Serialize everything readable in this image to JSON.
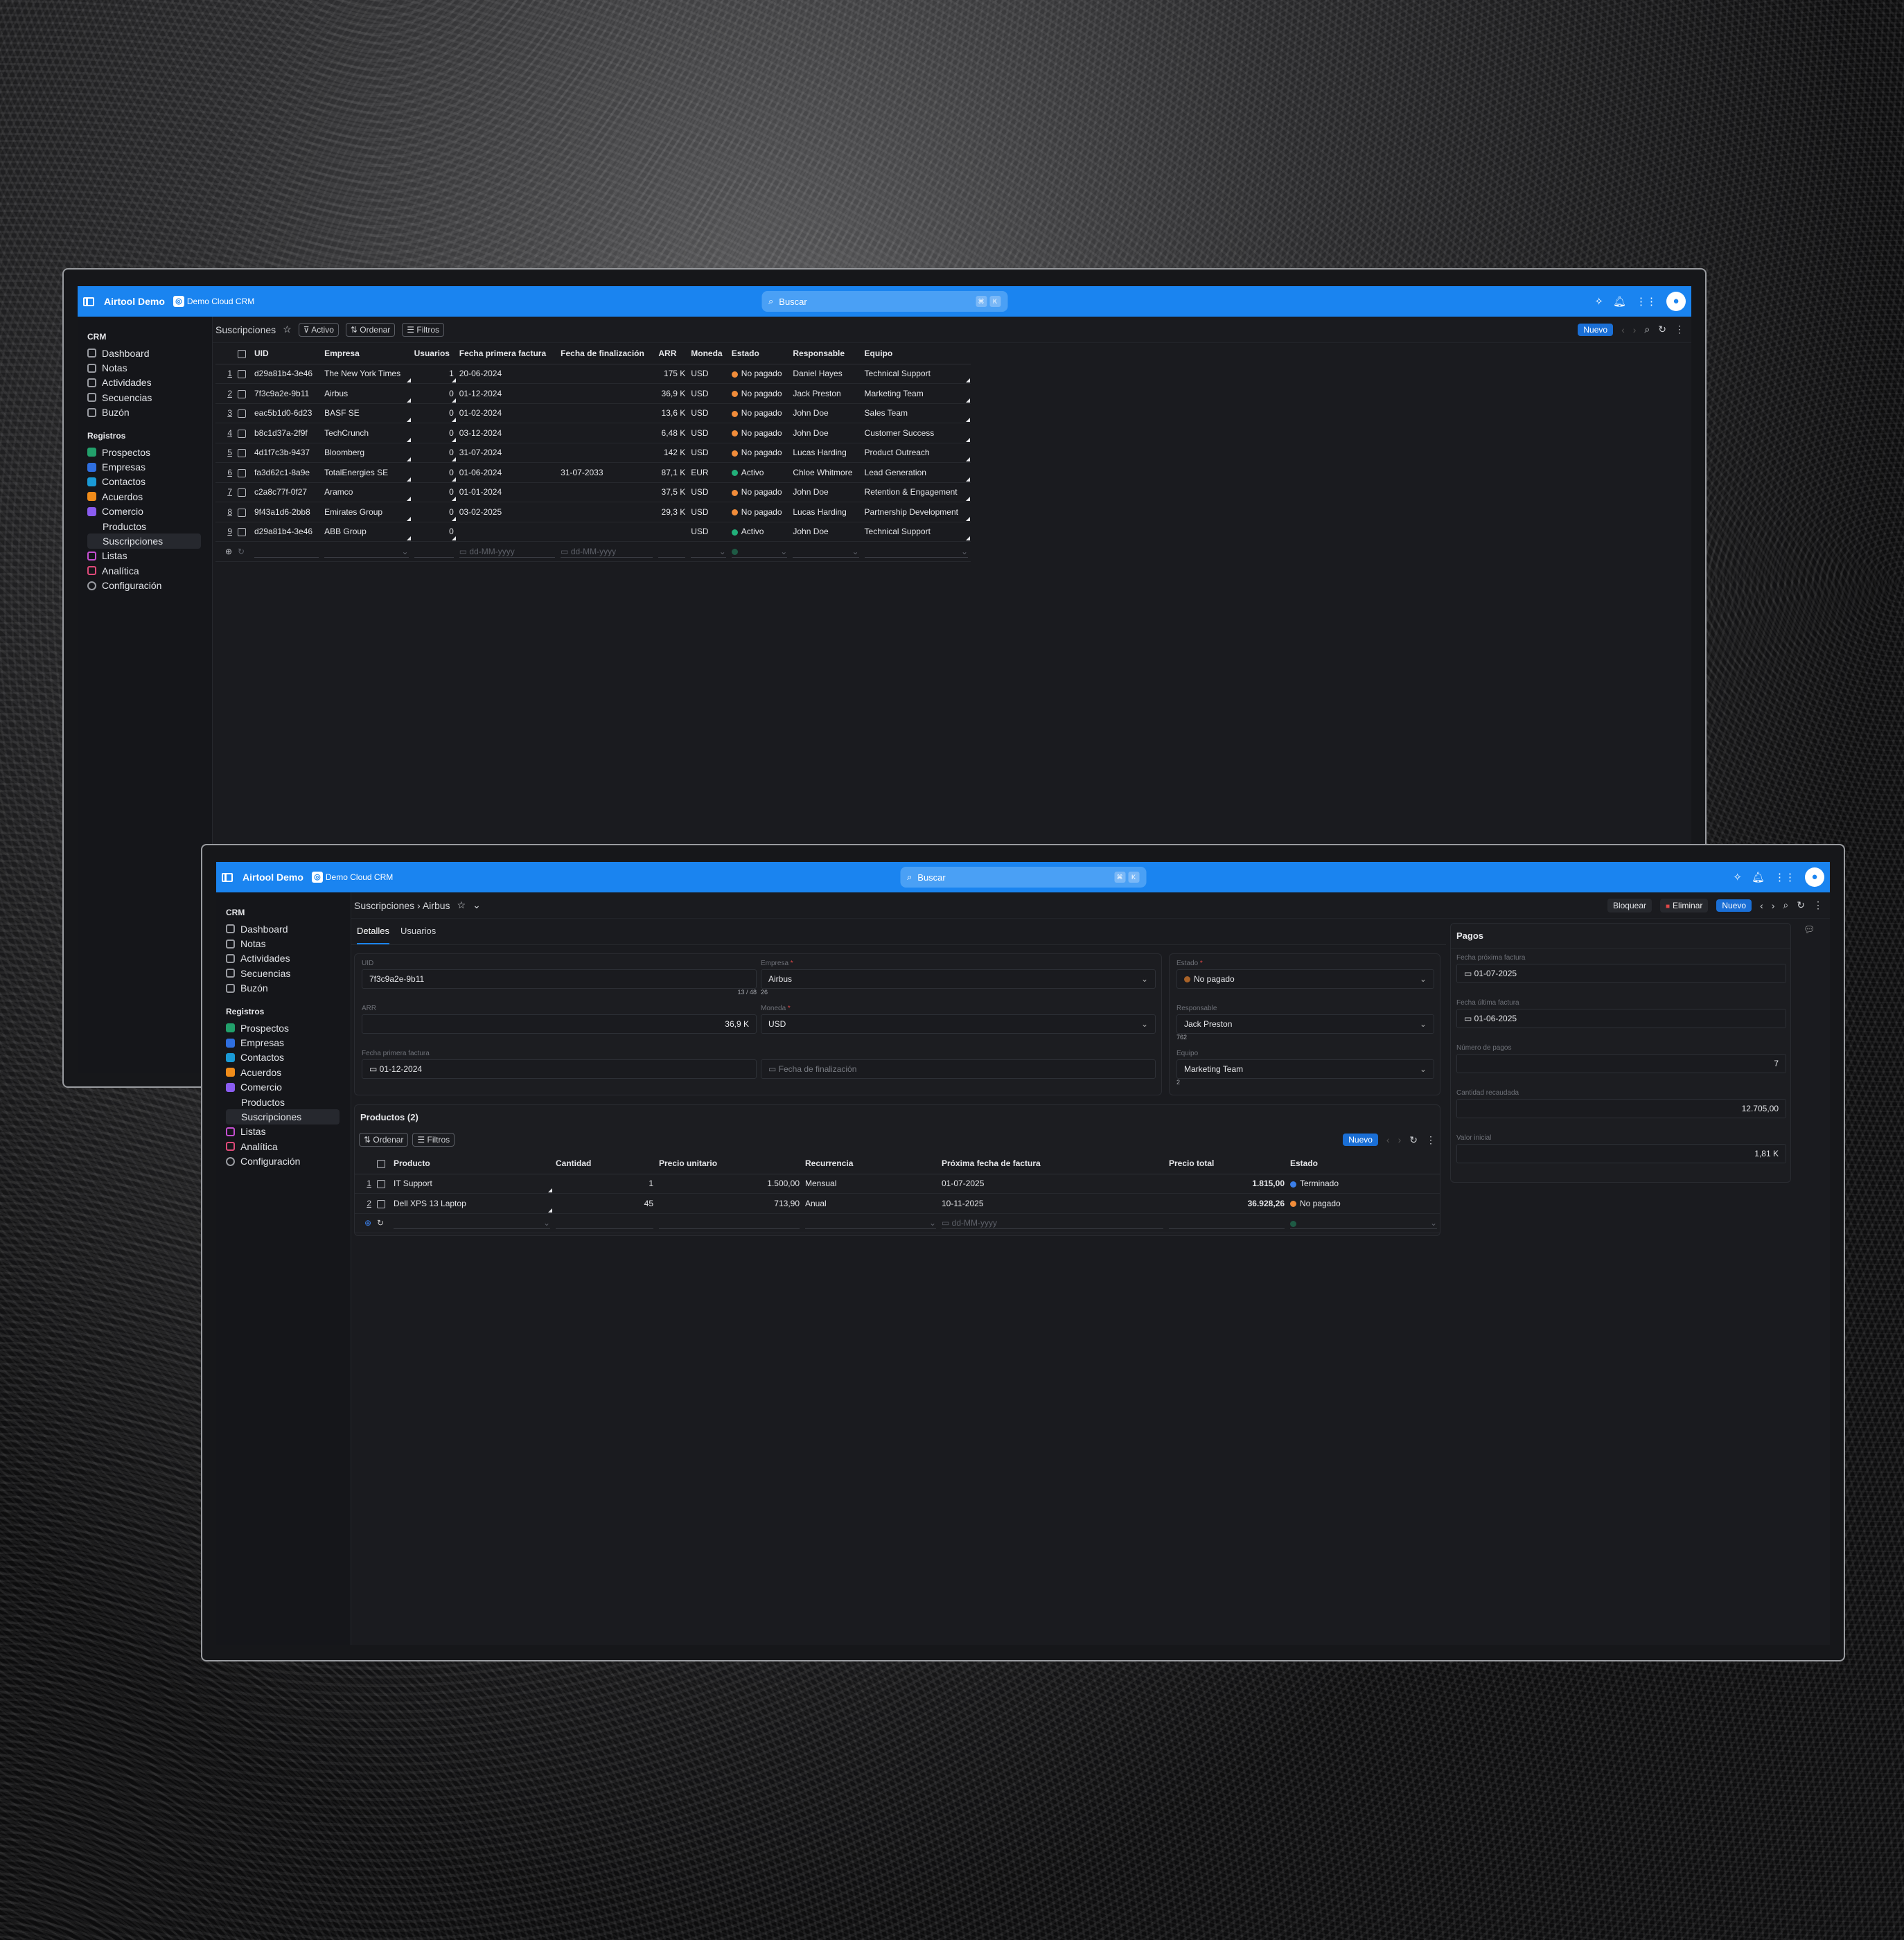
{
  "app_name": "Airtool Demo",
  "workspace": "Demo Cloud CRM",
  "search_placeholder": "Buscar",
  "shortcut": [
    "⌘",
    "K"
  ],
  "sidebar": {
    "crm_label": "CRM",
    "crm_items": [
      "Dashboard",
      "Notas",
      "Actividades",
      "Secuencias",
      "Buzón"
    ],
    "records_label": "Registros",
    "records_items": [
      {
        "label": "Prospectos",
        "color": "#22a06b"
      },
      {
        "label": "Empresas",
        "color": "#2f6fe0"
      },
      {
        "label": "Contactos",
        "color": "#1a9ad6"
      },
      {
        "label": "Acuerdos",
        "color": "#f08c1a"
      },
      {
        "label": "Comercio",
        "color": "#8a5cf0"
      }
    ],
    "sub_items": [
      "Productos",
      "Suscripciones"
    ],
    "after_items": [
      {
        "label": "Listas",
        "color": "#c54fd1"
      },
      {
        "label": "Analítica",
        "color": "#e04a7a"
      },
      {
        "label": "Configuración",
        "color": "#9a9ca2"
      }
    ]
  },
  "list_view": {
    "title": "Suscripciones",
    "chips": [
      "Activo",
      "Ordenar",
      "Filtros"
    ],
    "new_label": "Nuevo",
    "columns": [
      "UID",
      "Empresa",
      "Usuarios",
      "Fecha primera factura",
      "Fecha de finalización",
      "ARR",
      "Moneda",
      "Estado",
      "Responsable",
      "Equipo"
    ],
    "rows": [
      {
        "n": "1",
        "uid": "d29a81b4-3e46",
        "empresa": "The New York Times",
        "usuarios": "1",
        "fpf": "20-06-2024",
        "ff": "",
        "arr": "175 K",
        "moneda": "USD",
        "estado": "No pagado",
        "resp": "Daniel Hayes",
        "equipo": "Technical Support"
      },
      {
        "n": "2",
        "uid": "7f3c9a2e-9b11",
        "empresa": "Airbus",
        "usuarios": "0",
        "fpf": "01-12-2024",
        "ff": "",
        "arr": "36,9 K",
        "moneda": "USD",
        "estado": "No pagado",
        "resp": "Jack Preston",
        "equipo": "Marketing Team"
      },
      {
        "n": "3",
        "uid": "eac5b1d0-6d23",
        "empresa": "BASF SE",
        "usuarios": "0",
        "fpf": "01-02-2024",
        "ff": "",
        "arr": "13,6 K",
        "moneda": "USD",
        "estado": "No pagado",
        "resp": "John Doe",
        "equipo": "Sales Team"
      },
      {
        "n": "4",
        "uid": "b8c1d37a-2f9f",
        "empresa": "TechCrunch",
        "usuarios": "0",
        "fpf": "03-12-2024",
        "ff": "",
        "arr": "6,48 K",
        "moneda": "USD",
        "estado": "No pagado",
        "resp": "John Doe",
        "equipo": "Customer Success"
      },
      {
        "n": "5",
        "uid": "4d1f7c3b-9437",
        "empresa": "Bloomberg",
        "usuarios": "0",
        "fpf": "31-07-2024",
        "ff": "",
        "arr": "142 K",
        "moneda": "USD",
        "estado": "No pagado",
        "resp": "Lucas Harding",
        "equipo": "Product Outreach"
      },
      {
        "n": "6",
        "uid": "fa3d62c1-8a9e",
        "empresa": "TotalEnergies SE",
        "usuarios": "0",
        "fpf": "01-06-2024",
        "ff": "31-07-2033",
        "arr": "87,1 K",
        "moneda": "EUR",
        "estado": "Activo",
        "resp": "Chloe Whitmore",
        "equipo": "Lead Generation"
      },
      {
        "n": "7",
        "uid": "c2a8c77f-0f27",
        "empresa": "Aramco",
        "usuarios": "0",
        "fpf": "01-01-2024",
        "ff": "",
        "arr": "37,5 K",
        "moneda": "USD",
        "estado": "No pagado",
        "resp": "John Doe",
        "equipo": "Retention & Engagement"
      },
      {
        "n": "8",
        "uid": "9f43a1d6-2bb8",
        "empresa": "Emirates Group",
        "usuarios": "0",
        "fpf": "03-02-2025",
        "ff": "",
        "arr": "29,3 K",
        "moneda": "USD",
        "estado": "No pagado",
        "resp": "Lucas Harding",
        "equipo": "Partnership Development"
      },
      {
        "n": "9",
        "uid": "d29a81b4-3e46",
        "empresa": "ABB Group",
        "usuarios": "0",
        "fpf": "",
        "ff": "",
        "arr": "",
        "moneda": "USD",
        "estado": "Activo",
        "resp": "John Doe",
        "equipo": "Technical Support"
      }
    ],
    "date_placeholder": "dd-MM-yyyy",
    "status_colors": {
      "No pagado": "#f08c3a",
      "Activo": "#22b07a",
      "Terminado": "#3a7ee8"
    }
  },
  "detail_view": {
    "breadcrumb": [
      "Suscripciones",
      "Airbus"
    ],
    "actions": {
      "lock": "Bloquear",
      "delete": "Eliminar",
      "new": "Nuevo"
    },
    "tabs": [
      "Detalles",
      "Usuarios"
    ],
    "fields": {
      "uid_label": "UID",
      "uid_value": "7f3c9a2e-9b11",
      "uid_hint": "13 / 48",
      "empresa_label": "Empresa",
      "empresa_value": "Airbus",
      "empresa_hint": "26",
      "arr_label": "ARR",
      "arr_value": "36,9 K",
      "moneda_label": "Moneda",
      "moneda_value": "USD",
      "fpf_label": "Fecha primera factura",
      "fpf_value": "01-12-2024",
      "ff_placeholder": "Fecha de finalización",
      "estado_label": "Estado",
      "estado_value": "No pagado",
      "resp_label": "Responsable",
      "resp_value": "Jack Preston",
      "resp_hint": "762",
      "equipo_label": "Equipo",
      "equipo_value": "Marketing Team",
      "equipo_hint": "2"
    },
    "products": {
      "title": "Productos (2)",
      "chips": [
        "Ordenar",
        "Filtros"
      ],
      "new_label": "Nuevo",
      "columns": [
        "Producto",
        "Cantidad",
        "Precio unitario",
        "Recurrencia",
        "Próxima fecha de factura",
        "Precio total",
        "Estado"
      ],
      "rows": [
        {
          "n": "1",
          "producto": "IT Support",
          "cantidad": "1",
          "precio": "1.500,00",
          "rec": "Mensual",
          "prox": "01-07-2025",
          "total": "1.815,00",
          "estado": "Terminado"
        },
        {
          "n": "2",
          "producto": "Dell XPS 13 Laptop",
          "cantidad": "45",
          "precio": "713,90",
          "rec": "Anual",
          "prox": "10-11-2025",
          "total": "36.928,26",
          "estado": "No pagado"
        }
      ],
      "date_placeholder": "dd-MM-yyyy"
    },
    "payments": {
      "title": "Pagos",
      "next_label": "Fecha próxima factura",
      "next_value": "01-07-2025",
      "last_label": "Fecha última factura",
      "last_value": "01-06-2025",
      "count_label": "Número de pagos",
      "count_value": "7",
      "collected_label": "Cantidad recaudada",
      "collected_value": "12.705,00",
      "initial_label": "Valor inicial",
      "initial_value": "1,81 K"
    }
  }
}
